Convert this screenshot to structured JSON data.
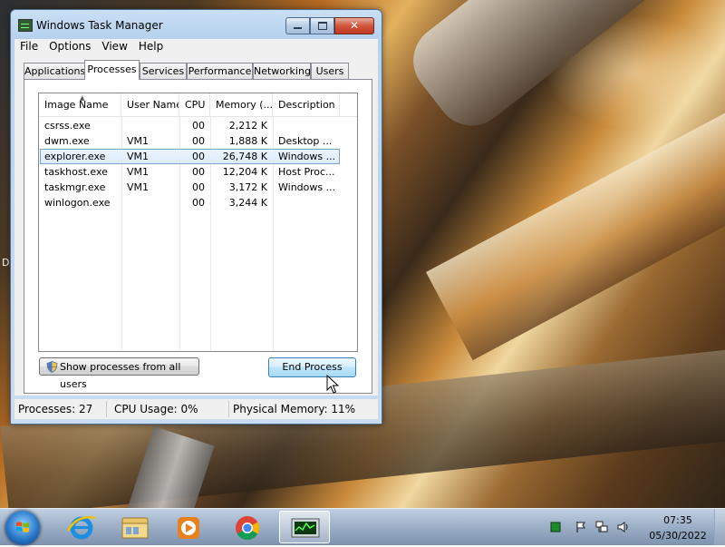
{
  "desktop": {
    "edge_letter": "D"
  },
  "window": {
    "title": "Windows Task Manager",
    "menu": [
      "File",
      "Options",
      "View",
      "Help"
    ],
    "tabs": [
      "Applications",
      "Processes",
      "Services",
      "Performance",
      "Networking",
      "Users"
    ],
    "active_tab": "Processes",
    "columns": [
      "Image Name",
      "User Name",
      "CPU",
      "Memory (...",
      "Description"
    ],
    "processes": [
      {
        "image": "csrss.exe",
        "user": "",
        "cpu": "00",
        "memory": "2,212 K",
        "description": ""
      },
      {
        "image": "dwm.exe",
        "user": "VM1",
        "cpu": "00",
        "memory": "1,888 K",
        "description": "Desktop ..."
      },
      {
        "image": "explorer.exe",
        "user": "VM1",
        "cpu": "00",
        "memory": "26,748 K",
        "description": "Windows ...",
        "selected": true
      },
      {
        "image": "taskhost.exe",
        "user": "VM1",
        "cpu": "00",
        "memory": "12,204 K",
        "description": "Host Proc..."
      },
      {
        "image": "taskmgr.exe",
        "user": "VM1",
        "cpu": "00",
        "memory": "3,172 K",
        "description": "Windows ..."
      },
      {
        "image": "winlogon.exe",
        "user": "",
        "cpu": "00",
        "memory": "3,244 K",
        "description": ""
      }
    ],
    "show_all_label": "Show processes from all users",
    "end_process_label": "End Process",
    "status": {
      "processes": "Processes: 27",
      "cpu": "CPU Usage: 0%",
      "memory": "Physical Memory: 11%"
    }
  },
  "taskbar": {
    "apps": [
      "start-orb",
      "internet-explorer-icon",
      "windows-explorer-icon",
      "media-player-icon",
      "chrome-icon",
      "task-manager-icon"
    ],
    "active_app": "task-manager-icon",
    "clock_time": "07:35",
    "clock_date": "05/30/2022"
  },
  "colors": {
    "selection": "#dcebfc",
    "title_glass": "#b7d2ee",
    "close_button": "#c23a21"
  }
}
